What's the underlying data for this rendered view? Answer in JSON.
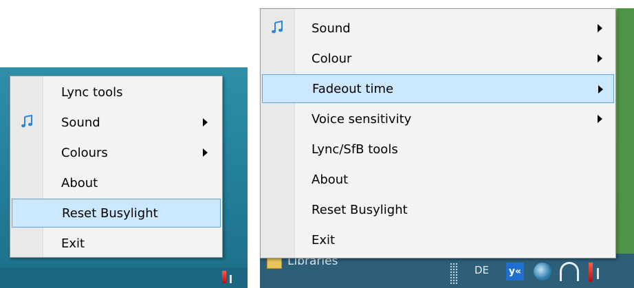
{
  "left_menu": {
    "items": [
      {
        "label": "Lync tools",
        "submenu": false,
        "icon": null,
        "highlighted": false
      },
      {
        "label": "Sound",
        "submenu": true,
        "icon": "music-note-icon",
        "highlighted": false
      },
      {
        "label": "Colours",
        "submenu": true,
        "icon": null,
        "highlighted": false
      },
      {
        "label": "About",
        "submenu": false,
        "icon": null,
        "highlighted": false
      },
      {
        "label": "Reset Busylight",
        "submenu": false,
        "icon": null,
        "highlighted": true
      },
      {
        "label": "Exit",
        "submenu": false,
        "icon": null,
        "highlighted": false
      }
    ]
  },
  "right_menu": {
    "items": [
      {
        "label": "Sound",
        "submenu": true,
        "icon": "music-note-icon",
        "highlighted": false
      },
      {
        "label": "Colour",
        "submenu": true,
        "icon": null,
        "highlighted": false
      },
      {
        "label": "Fadeout time",
        "submenu": true,
        "icon": null,
        "highlighted": true
      },
      {
        "label": "Voice sensitivity",
        "submenu": true,
        "icon": null,
        "highlighted": false
      },
      {
        "label": "Lync/SfB tools",
        "submenu": false,
        "icon": null,
        "highlighted": false
      },
      {
        "label": "About",
        "submenu": false,
        "icon": null,
        "highlighted": false
      },
      {
        "label": "Reset Busylight",
        "submenu": false,
        "icon": null,
        "highlighted": false
      },
      {
        "label": "Exit",
        "submenu": false,
        "icon": null,
        "highlighted": false
      }
    ]
  },
  "right_taskbar": {
    "libraries_label": "Libraries",
    "language": "DE",
    "ys_label": "y«"
  },
  "colors": {
    "menu_background": "#f3f3f3",
    "highlight_fill": "#cce8ff",
    "highlight_border": "#5ba4e6",
    "music_icon": "#2f86d6"
  }
}
